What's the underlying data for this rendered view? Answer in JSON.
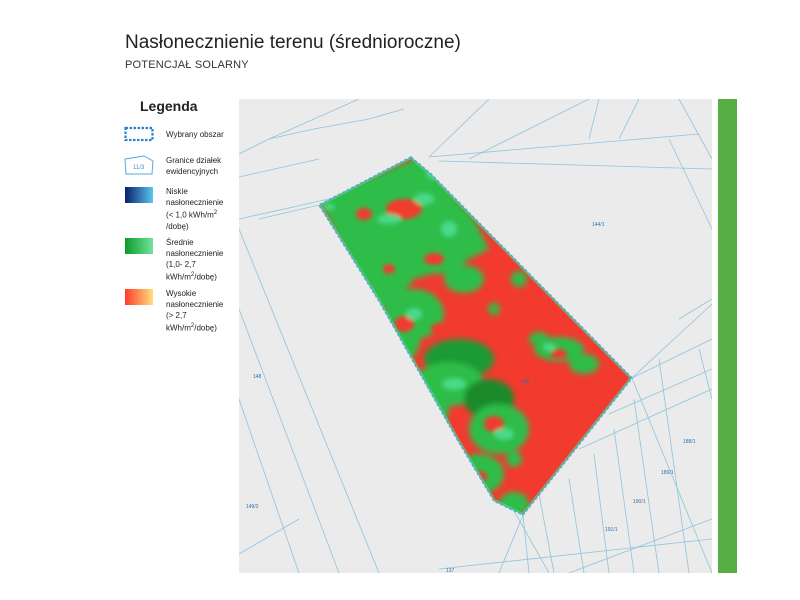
{
  "header": {
    "title": "Nasłonecznienie terenu (średnioroczne)",
    "subtitle": "POTENCJAŁ SOLARNY"
  },
  "legend": {
    "title": "Legenda",
    "items": [
      {
        "label": "Wybrany obszar",
        "icon": "selected-area-swatch"
      },
      {
        "label": "Granice działek ewidencyjnych",
        "icon": "parcel-boundary-swatch",
        "sample": "11/3"
      },
      {
        "label_html": "Niskie nasłonecznienie (< 1,0 kWh/m² /dobę)",
        "line1": "Niskie",
        "line2": "nasłonecznienie",
        "line3": "(< 1,0 kWh/m",
        "sup": "2",
        "line4": "/dobę)",
        "gradient": [
          "#0b1f6e",
          "#5bc6f0"
        ]
      },
      {
        "line1": "Średnie",
        "line2": "nasłonecznienie",
        "line3": "(1,0- 2,7",
        "line4a": "kWh/m",
        "sup": "2",
        "line4b": "/dobę)",
        "gradient": [
          "#0f9a2a",
          "#6fe3a0"
        ]
      },
      {
        "line1": "Wysokie",
        "line2": "nasłonecznienie",
        "line3": "(> 2,7",
        "line4a": "kWh/m",
        "sup": "2",
        "line4b": "/dobę)",
        "gradient": [
          "#ff3b2f",
          "#ffe07a"
        ]
      }
    ]
  },
  "map": {
    "parcel_labels": [
      "144/1",
      "148",
      "145",
      "188/1",
      "189/1",
      "190/1",
      "191/1",
      "149/2",
      "137"
    ],
    "colors": {
      "background": "#ebebeb",
      "parcel_line": "#8fc3e0",
      "high": "#f23a2f",
      "medium": "#2dbd4a",
      "medium_light": "#49d98a",
      "dark_green": "#1e8a2c",
      "outline": "#5aa7dc"
    }
  },
  "side_bar": {
    "color": "#56ae45"
  }
}
